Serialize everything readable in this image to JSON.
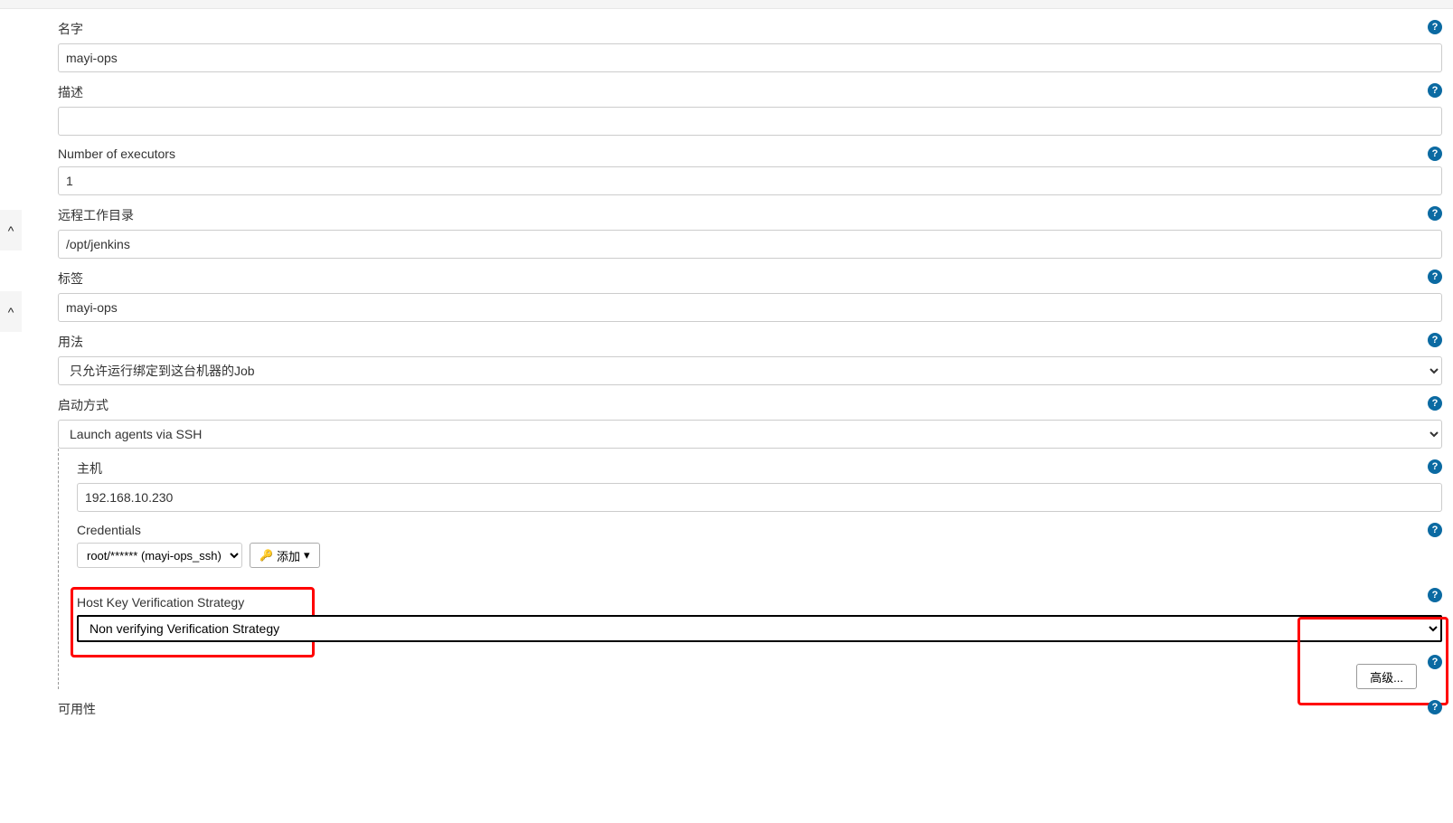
{
  "labels": {
    "name": "名字",
    "description": "描述",
    "executors": "Number of executors",
    "remote_dir": "远程工作目录",
    "tags": "标签",
    "usage": "用法",
    "launch": "启动方式",
    "host": "主机",
    "credentials": "Credentials",
    "hkv": "Host Key Verification Strategy",
    "availability": "可用性",
    "add_button": "添加",
    "advanced_button": "高级..."
  },
  "values": {
    "name": "mayi-ops",
    "description": "",
    "executors": "1",
    "remote_dir": "/opt/jenkins",
    "tags": "mayi-ops",
    "usage": "只允许运行绑定到这台机器的Job",
    "launch": "Launch agents via SSH",
    "host": "192.168.10.230",
    "credentials": "root/****** (mayi-ops_ssh)",
    "hkv": "Non verifying Verification Strategy"
  }
}
